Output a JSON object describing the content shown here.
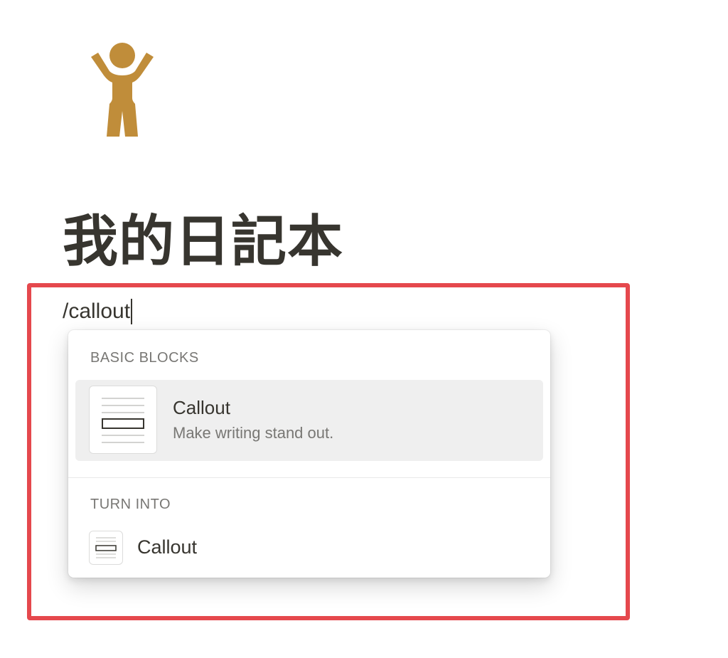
{
  "page": {
    "icon": "person-raising-arms-icon",
    "icon_color": "#c08d3a",
    "title": "我的日記本"
  },
  "editor": {
    "slash_command": "/callout"
  },
  "highlight_color": "#e5484d",
  "slash_menu": {
    "sections": [
      {
        "label": "BASIC BLOCKS",
        "items": [
          {
            "title": "Callout",
            "description": "Make writing stand out.",
            "icon": "callout-block-icon",
            "selected": true
          }
        ]
      },
      {
        "label": "TURN INTO",
        "items": [
          {
            "title": "Callout",
            "icon": "callout-block-icon",
            "selected": false
          }
        ]
      }
    ]
  }
}
